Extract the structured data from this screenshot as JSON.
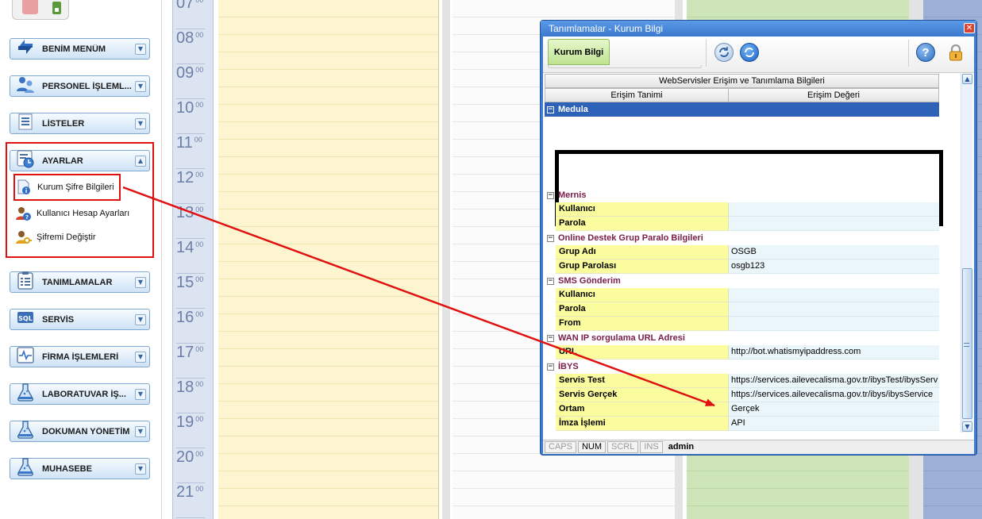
{
  "sidebar": {
    "menus": [
      {
        "id": "benim-menum",
        "label": "BENİM MENÜM",
        "icon": "star-arrows-icon"
      },
      {
        "id": "personel",
        "label": "PERSONEL İŞLEML...",
        "icon": "users-icon"
      },
      {
        "id": "listeler",
        "label": "LİSTELER",
        "icon": "list-icon"
      },
      {
        "id": "ayarlar",
        "label": "AYARLAR",
        "icon": "settings-clock-icon",
        "expanded": true
      },
      {
        "id": "tanimlamalar",
        "label": "TANIMLAMALAR",
        "icon": "clipboard-icon"
      },
      {
        "id": "servis",
        "label": "SERVİS",
        "icon": "sql-icon"
      },
      {
        "id": "firma",
        "label": "FİRMA İŞLEMLERİ",
        "icon": "heartbeat-icon"
      },
      {
        "id": "laboratuvar",
        "label": "LABORATUVAR İŞ...",
        "icon": "flask-icon"
      },
      {
        "id": "dokuman",
        "label": "DOKUMAN YÖNETİM",
        "icon": "flask-icon"
      },
      {
        "id": "muhasebe",
        "label": "MUHASEBE",
        "icon": "flask-icon"
      }
    ],
    "ayarlar_items": [
      {
        "label": "Kurum Şifre Bilgileri",
        "icon": "info-document-icon"
      },
      {
        "label": "Kullanıcı Hesap Ayarları",
        "icon": "user-help-icon"
      },
      {
        "label": "Şifremi Değiştir",
        "icon": "user-key-icon"
      }
    ]
  },
  "calendar": {
    "hours": [
      "07",
      "08",
      "09",
      "10",
      "11",
      "12",
      "13",
      "14",
      "15",
      "16",
      "17",
      "18",
      "19",
      "20",
      "21"
    ],
    "minutes": "00",
    "colors": {
      "yellow": "#fdf5cf",
      "white": "#fbfbfb",
      "green": "#cde5b8",
      "blue": "#9fb0d6"
    }
  },
  "dialog": {
    "title": "Tanımlamalar - Kurum Bilgi",
    "close_label": "✕",
    "ribbon_tab": "Kurum Bilgi",
    "grid": {
      "header_title": "WebServisler Erişim ve Tanımlama Bilgileri",
      "col_name": "Erişim Tanimi",
      "col_value": "Erişim Değeri",
      "categories": [
        {
          "name": "Medula",
          "selected": true,
          "redacted": true,
          "rows": []
        },
        {
          "name": "Mernis",
          "rows": [
            {
              "name": "Kullanıcı",
              "value": ""
            },
            {
              "name": "Parola",
              "value": ""
            }
          ]
        },
        {
          "name": "Online Destek Grup Paralo Bilgileri",
          "rows": [
            {
              "name": "Grup Adı",
              "value": "OSGB"
            },
            {
              "name": "Grup Parolası",
              "value": "osgb123"
            }
          ]
        },
        {
          "name": "SMS Gönderim",
          "rows": [
            {
              "name": "Kullanıcı",
              "value": ""
            },
            {
              "name": "Parola",
              "value": ""
            },
            {
              "name": "From",
              "value": ""
            }
          ]
        },
        {
          "name": "WAN IP sorgulama URL Adresi",
          "rows": [
            {
              "name": "URL",
              "value": "http://bot.whatismyipaddress.com"
            }
          ]
        },
        {
          "name": "İBYS",
          "rows": [
            {
              "name": "Servis Test",
              "value": "https://services.ailevecalisma.gov.tr/ibysTest/ibysServ"
            },
            {
              "name": "Servis Gerçek",
              "value": "https://services.ailevecalisma.gov.tr/ibys/ibysService"
            },
            {
              "name": "Ortam",
              "value": "Gerçek"
            },
            {
              "name": "İmza İşlemi",
              "value": "API"
            }
          ]
        }
      ]
    },
    "status": {
      "caps": "CAPS",
      "num": "NUM",
      "scrl": "SCRL",
      "ins": "INS",
      "user": "admin"
    }
  },
  "annotation_color": "#e01010"
}
